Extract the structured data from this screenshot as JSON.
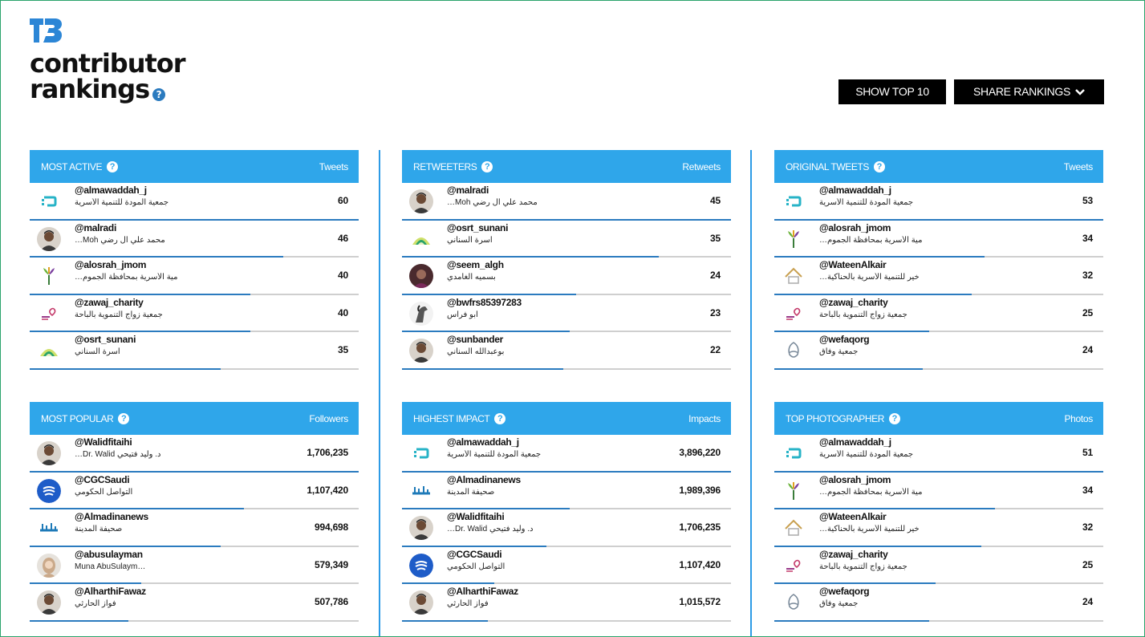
{
  "header": {
    "title_line1": "contributor",
    "title_line2": "rankings",
    "help_glyph": "?"
  },
  "toolbar": {
    "show_top": "SHOW TOP 10",
    "share": "SHARE RANKINGS"
  },
  "colors": {
    "header_blue": "#2fa6ea",
    "bar_blue": "#2b7bbf",
    "divider_blue": "#2d9be6",
    "frame_green": "#2aa36b"
  },
  "panels": [
    {
      "title": "MOST ACTIVE",
      "metric": "Tweets",
      "rows": [
        {
          "handle": "@almawaddah_j",
          "name": "جمعية المودة للتنمية الأسرية",
          "value": "60",
          "fraction": 1.0,
          "icon": "mawaddah-logo-icon"
        },
        {
          "handle": "@malradi",
          "name": "…Moh محمد علي ال رضي",
          "value": "46",
          "fraction": 0.77,
          "icon": "photo-man-icon"
        },
        {
          "handle": "@alosrah_jmom",
          "name": "…مية الأسرية بمحافظة الجموم",
          "value": "40",
          "fraction": 0.67,
          "icon": "alosrah-logo-icon"
        },
        {
          "handle": "@zawaj_charity",
          "name": "جمعية زواج التنموية بالباحة",
          "value": "40",
          "fraction": 0.67,
          "icon": "zawaj-logo-icon"
        },
        {
          "handle": "@osrt_sunani",
          "name": "أسرة السناني",
          "value": "35",
          "fraction": 0.58,
          "icon": "sunani-logo-icon"
        }
      ]
    },
    {
      "title": "RETWEETERS",
      "metric": "Retweets",
      "rows": [
        {
          "handle": "@malradi",
          "name": "…Moh محمد علي ال رضي",
          "value": "45",
          "fraction": 1.0,
          "icon": "photo-man-icon"
        },
        {
          "handle": "@osrt_sunani",
          "name": "أسرة السناني",
          "value": "35",
          "fraction": 0.78,
          "icon": "sunani-logo-icon"
        },
        {
          "handle": "@seem_algh",
          "name": "بسميه الغامدي",
          "value": "24",
          "fraction": 0.53,
          "icon": "photo-person-icon"
        },
        {
          "handle": "@bwfrs85397283",
          "name": "أبو فراس",
          "value": "23",
          "fraction": 0.51,
          "icon": "horse-icon"
        },
        {
          "handle": "@sunbander",
          "name": "بوعبدالله السناني",
          "value": "22",
          "fraction": 0.49,
          "icon": "photo-man-icon"
        }
      ]
    },
    {
      "title": "ORIGINAL TWEETS",
      "metric": "Tweets",
      "rows": [
        {
          "handle": "@almawaddah_j",
          "name": "جمعية المودة للتنمية الأسرية",
          "value": "53",
          "fraction": 1.0,
          "icon": "mawaddah-logo-icon"
        },
        {
          "handle": "@alosrah_jmom",
          "name": "…مية الأسرية بمحافظة الجموم",
          "value": "34",
          "fraction": 0.64,
          "icon": "alosrah-logo-icon"
        },
        {
          "handle": "@WateenAlkair",
          "name": "…خير للتنمية الأسرية بالحناكية",
          "value": "32",
          "fraction": 0.6,
          "icon": "wateen-logo-icon"
        },
        {
          "handle": "@zawaj_charity",
          "name": "جمعية زواج التنموية بالباحة",
          "value": "25",
          "fraction": 0.47,
          "icon": "zawaj-logo-icon"
        },
        {
          "handle": "@wefaqorg",
          "name": "جمعية وفاق",
          "value": "24",
          "fraction": 0.45,
          "icon": "wefaq-logo-icon"
        }
      ]
    },
    {
      "title": "MOST POPULAR",
      "metric": "Followers",
      "rows": [
        {
          "handle": "@Walidfitaihi",
          "name": "…Dr. Walid د. وليد فتيحي",
          "value": "1,706,235",
          "fraction": 1.0,
          "icon": "photo-man-icon"
        },
        {
          "handle": "@CGCSaudi",
          "name": "التواصل الحكومي",
          "value": "1,107,420",
          "fraction": 0.65,
          "icon": "cgc-logo-icon"
        },
        {
          "handle": "@Almadinanews",
          "name": "صحيفة المدينة",
          "value": "994,698",
          "fraction": 0.58,
          "icon": "madina-logo-icon"
        },
        {
          "handle": "@abusulayman",
          "name": "Muna AbuSulaym…",
          "value": "579,349",
          "fraction": 0.34,
          "icon": "photo-woman-icon"
        },
        {
          "handle": "@AlharthiFawaz",
          "name": "فواز الحارثي",
          "value": "507,786",
          "fraction": 0.3,
          "icon": "photo-man-icon"
        }
      ]
    },
    {
      "title": "HIGHEST IMPACT",
      "metric": "Impacts",
      "rows": [
        {
          "handle": "@almawaddah_j",
          "name": "جمعية المودة للتنمية الأسرية",
          "value": "3,896,220",
          "fraction": 1.0,
          "icon": "mawaddah-logo-icon"
        },
        {
          "handle": "@Almadinanews",
          "name": "صحيفة المدينة",
          "value": "1,989,396",
          "fraction": 0.51,
          "icon": "madina-logo-icon"
        },
        {
          "handle": "@Walidfitaihi",
          "name": "…Dr. Walid د. وليد فتيحي",
          "value": "1,706,235",
          "fraction": 0.44,
          "icon": "photo-man-icon"
        },
        {
          "handle": "@CGCSaudi",
          "name": "التواصل الحكومي",
          "value": "1,107,420",
          "fraction": 0.28,
          "icon": "cgc-logo-icon"
        },
        {
          "handle": "@AlharthiFawaz",
          "name": "فواز الحارثي",
          "value": "1,015,572",
          "fraction": 0.26,
          "icon": "photo-man-icon"
        }
      ]
    },
    {
      "title": "TOP PHOTOGRAPHER",
      "metric": "Photos",
      "rows": [
        {
          "handle": "@almawaddah_j",
          "name": "جمعية المودة للتنمية الأسرية",
          "value": "51",
          "fraction": 1.0,
          "icon": "mawaddah-logo-icon"
        },
        {
          "handle": "@alosrah_jmom",
          "name": "…مية الأسرية بمحافظة الجموم",
          "value": "34",
          "fraction": 0.67,
          "icon": "alosrah-logo-icon"
        },
        {
          "handle": "@WateenAlkair",
          "name": "…خير للتنمية الأسرية بالحناكية",
          "value": "32",
          "fraction": 0.63,
          "icon": "wateen-logo-icon"
        },
        {
          "handle": "@zawaj_charity",
          "name": "جمعية زواج التنموية بالباحة",
          "value": "25",
          "fraction": 0.49,
          "icon": "zawaj-logo-icon"
        },
        {
          "handle": "@wefaqorg",
          "name": "جمعية وفاق",
          "value": "24",
          "fraction": 0.47,
          "icon": "wefaq-logo-icon"
        }
      ]
    }
  ]
}
